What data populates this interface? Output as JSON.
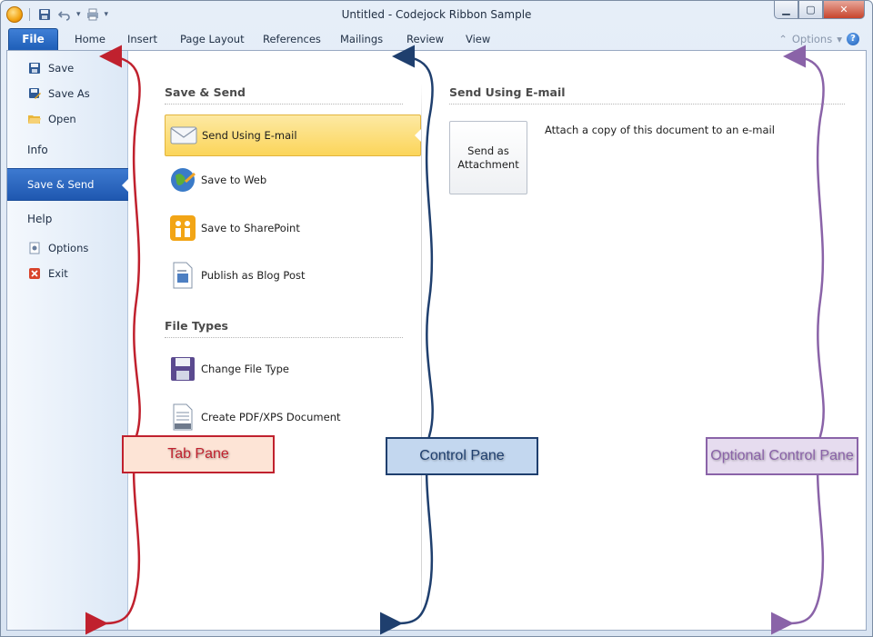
{
  "window": {
    "title": "Untitled - Codejock Ribbon Sample",
    "controls": {
      "minimize": "▁",
      "maximize": "▢",
      "close": "✕"
    }
  },
  "qat": {
    "save_icon": "save-icon",
    "undo_icon": "undo-icon",
    "print_icon": "print-icon"
  },
  "ribbon": {
    "file_tab": "File",
    "tabs": [
      "Home",
      "Insert",
      "Page Layout",
      "References",
      "Mailings",
      "Review",
      "View"
    ],
    "options_label": "Options",
    "help_label": "?"
  },
  "backstage": {
    "nav": [
      {
        "label": "Save",
        "icon": "save-icon"
      },
      {
        "label": "Save As",
        "icon": "save-as-icon"
      },
      {
        "label": "Open",
        "icon": "open-folder-icon"
      },
      {
        "label": "Info"
      },
      {
        "label": "Save & Send",
        "selected": true
      },
      {
        "label": "Help"
      },
      {
        "label": "Options",
        "icon": "options-icon"
      },
      {
        "label": "Exit",
        "icon": "exit-icon"
      }
    ],
    "control_pane": {
      "section1_title": "Save & Send",
      "section1_items": [
        {
          "label": "Send Using E-mail",
          "icon": "email-envelope-icon",
          "selected": true
        },
        {
          "label": "Save to Web",
          "icon": "globe-icon"
        },
        {
          "label": "Save to SharePoint",
          "icon": "sharepoint-icon"
        },
        {
          "label": "Publish as Blog Post",
          "icon": "blog-post-icon"
        }
      ],
      "section2_title": "File Types",
      "section2_items": [
        {
          "label": "Change File Type",
          "icon": "floppy-disk-icon"
        },
        {
          "label": "Create PDF/XPS Document",
          "icon": "pdf-document-icon"
        }
      ]
    },
    "optional_pane": {
      "title": "Send Using E-mail",
      "button_line1": "Send as",
      "button_line2": "Attachment",
      "description": "Attach a copy of this document to an e-mail"
    }
  },
  "annotations": {
    "tab_pane": "Tab Pane",
    "control_pane": "Control Pane",
    "optional_pane": "Optional Control Pane",
    "colors": {
      "tab_pane": "#c0212e",
      "control_pane": "#1f3f6e",
      "optional_pane": "#8a63a8"
    }
  }
}
